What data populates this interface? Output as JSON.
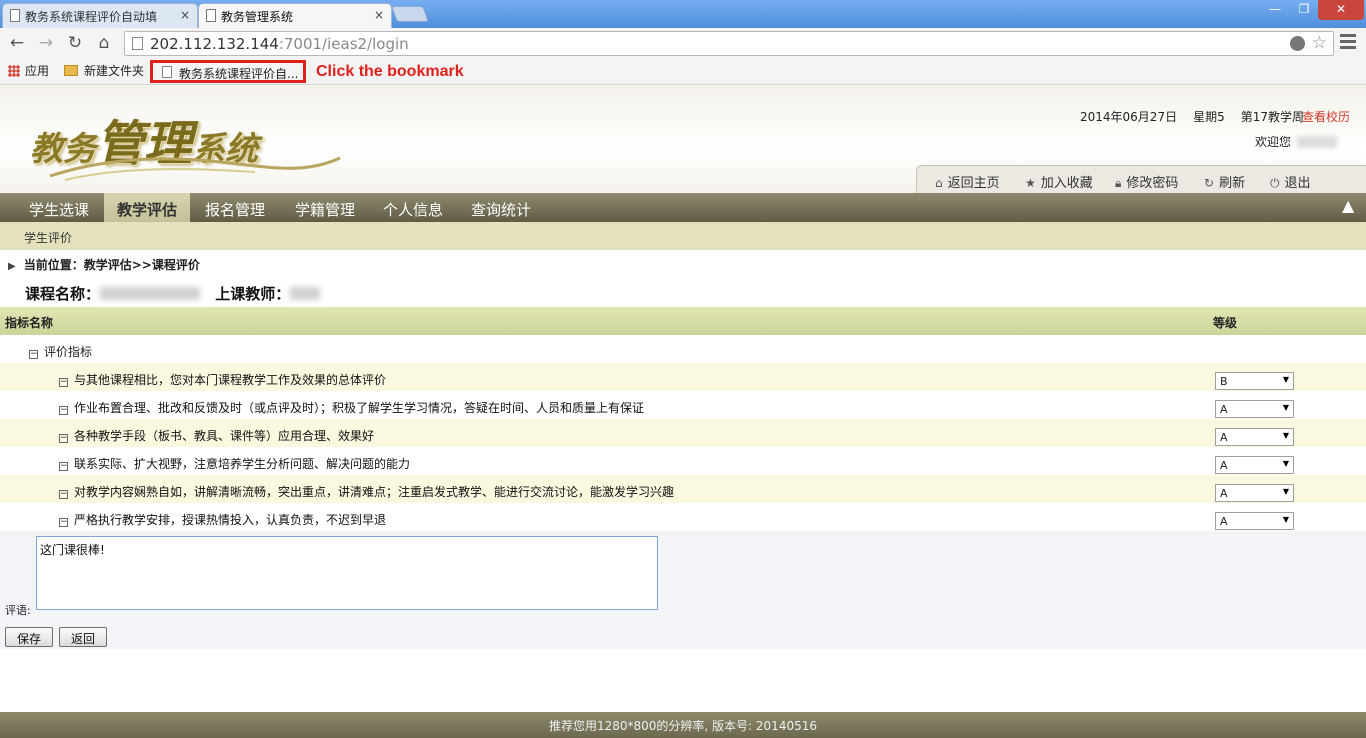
{
  "browser": {
    "tabs": [
      {
        "title": "教务系统课程评价自动填",
        "close": "×"
      },
      {
        "title": "教务管理系统",
        "close": "×"
      }
    ],
    "window_controls": {
      "min": "—",
      "max": "❐",
      "close": "✕"
    },
    "url_host": "202.112.132.144",
    "url_rest": ":7001/ieas2/login",
    "bookmarks": {
      "apps": "应用",
      "folder": "新建文件夹",
      "page": "教务系统课程评价自..."
    },
    "annotation": "Click the bookmark"
  },
  "header": {
    "logo_prefix": "教务",
    "logo_main": "管理",
    "logo_suffix": "系统",
    "date": "2014年06月27日",
    "weekday": "星期5",
    "week": "第17教学周",
    "calendar_link": "查看校历",
    "welcome": "欢迎您",
    "quick_links": [
      "返回主页",
      "加入收藏",
      "修改密码",
      "刷新",
      "退出"
    ]
  },
  "nav": {
    "items": [
      "学生选课",
      "教学评估",
      "报名管理",
      "学籍管理",
      "个人信息",
      "查询统计"
    ],
    "active": "教学评估",
    "sub": "学生评价"
  },
  "content": {
    "breadcrumb": "当前位置：教学评估>>课程评价",
    "course_label": "课程名称：",
    "teacher_label": "上课教师：",
    "col_name": "指标名称",
    "col_grade": "等级",
    "group": "评价指标",
    "rows": [
      {
        "text": "与其他课程相比，您对本门课程教学工作及效果的总体评价",
        "grade": "B"
      },
      {
        "text": "作业布置合理、批改和反馈及时（或点评及时）；积极了解学生学习情况，答疑在时间、人员和质量上有保证",
        "grade": "A"
      },
      {
        "text": "各种教学手段（板书、教具、课件等）应用合理、效果好",
        "grade": "A"
      },
      {
        "text": "联系实际、扩大视野，注意培养学生分析问题、解决问题的能力",
        "grade": "A"
      },
      {
        "text": "对教学内容娴熟自如，讲解清晰流畅，突出重点，讲清难点；注重启发式教学、能进行交流讨论，能激发学习兴趣",
        "grade": "A"
      },
      {
        "text": "严格执行教学安排，授课热情投入，认真负责，不迟到早退",
        "grade": "A"
      }
    ],
    "comment_label": "评语:",
    "comment_value": "这门课很棒!",
    "save": "保存",
    "back": "返回"
  },
  "footer": "推荐您用1280*800的分辨率, 版本号: 20140516",
  "colors": {
    "nav_bg": "#6f6c54",
    "sub_bg": "#e3e2bc",
    "accent_red": "#e0201b",
    "logo_gold": "#8a7a28"
  }
}
